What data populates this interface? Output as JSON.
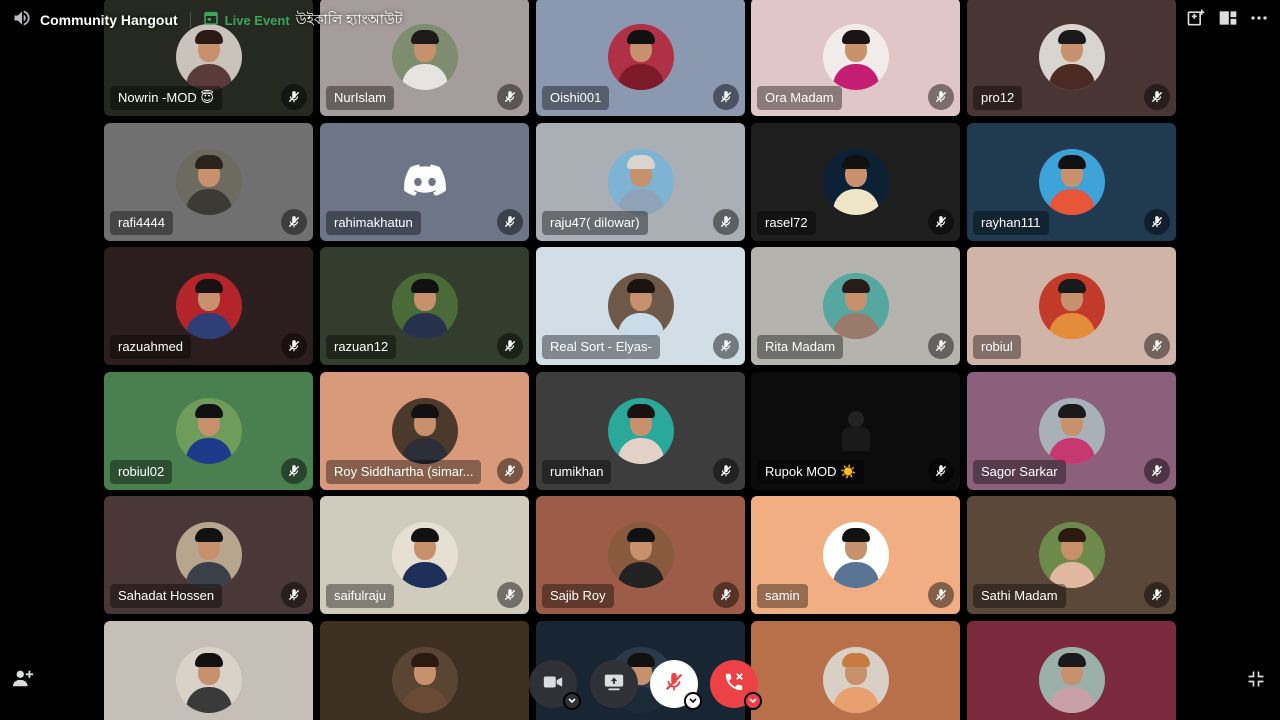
{
  "header": {
    "channel_name": "Community Hangout",
    "event_label": "Live Event",
    "event_name": "উইকালি হ্যাংআউট"
  },
  "participants": [
    {
      "name": "Nowrin -MOD 😇",
      "bg": "#25291f",
      "avatar": "#c9c3bb",
      "hair": "#2a1a14",
      "shirt": "#5b3a3a"
    },
    {
      "name": "NurIslam",
      "bg": "#a59d9c",
      "avatar": "#7e8c6f",
      "hair": "#1d1a18",
      "shirt": "#e6e4e0"
    },
    {
      "name": "Oishi001",
      "bg": "#8a98b0",
      "avatar": "#b03046",
      "hair": "#111",
      "shirt": "#7c1a2a"
    },
    {
      "name": "Ora Madam",
      "bg": "#e0c6c8",
      "avatar": "#f1ecea",
      "hair": "#1c1414",
      "shirt": "#c41e72"
    },
    {
      "name": "pro12",
      "bg": "#4a3535",
      "avatar": "#d8d4cf",
      "hair": "#1a1a1a",
      "shirt": "#4a2a22"
    },
    {
      "name": "rafi4444",
      "bg": "#707070",
      "avatar": "#6d6a60",
      "hair": "#2a241c",
      "shirt": "#3c3a34"
    },
    {
      "name": "rahimakhatun",
      "bg": "#6e7588",
      "avatar": "",
      "hair": "",
      "shirt": "",
      "discord": true
    },
    {
      "name": "raju47( dilowar)",
      "bg": "#a9afb5",
      "avatar": "#7eb3d4",
      "hair": "#d9d4cf",
      "shirt": "#8fa3b8"
    },
    {
      "name": "rasel72",
      "bg": "#1e1e1e",
      "avatar": "#0c2036",
      "hair": "#111",
      "shirt": "#efe6c8"
    },
    {
      "name": "rayhan111",
      "bg": "#203a50",
      "avatar": "#3da3d8",
      "hair": "#111",
      "shirt": "#e8563a"
    },
    {
      "name": "razuahmed",
      "bg": "#2c1e1e",
      "avatar": "#b3252a",
      "hair": "#1a1212",
      "shirt": "#2e3f78"
    },
    {
      "name": "razuan12",
      "bg": "#333d2d",
      "avatar": "#4a6a38",
      "hair": "#111",
      "shirt": "#25314d"
    },
    {
      "name": "Real Sort - Elyas-",
      "bg": "#d2dee6",
      "avatar": "#6e5848",
      "hair": "#1a1410",
      "shirt": "#c9dde8"
    },
    {
      "name": "Rita Madam",
      "bg": "#b4b3ae",
      "avatar": "#55a7a0",
      "hair": "#2a1c18",
      "shirt": "#9a7a6a"
    },
    {
      "name": "robiul",
      "bg": "#d1b4a8",
      "avatar": "#c23a2a",
      "hair": "#1a1a1a",
      "shirt": "#e58c3a"
    },
    {
      "name": "robiul02",
      "bg": "#4a7f4f",
      "avatar": "#6e9c5a",
      "hair": "#111",
      "shirt": "#1d3a8a"
    },
    {
      "name": "Roy Siddhartha (simar...",
      "bg": "#d99a7c",
      "avatar": "#4b3a2c",
      "hair": "#111",
      "shirt": "#2c2f38"
    },
    {
      "name": "rumikhan",
      "bg": "#3d3d3d",
      "avatar": "#2aa89a",
      "hair": "#1a1212",
      "shirt": "#e4d2c8"
    },
    {
      "name": "Rupok MOD ☀️",
      "bg": "#0c0c0c",
      "avatar": "",
      "hair": "",
      "shirt": "",
      "plain": true
    },
    {
      "name": "Sagor Sarkar",
      "bg": "#8c5f7c",
      "avatar": "#a8b0b8",
      "hair": "#1a1a1a",
      "shirt": "#c83870"
    },
    {
      "name": "Sahadat Hossen",
      "bg": "#4a3838",
      "avatar": "#b7a58e",
      "hair": "#111",
      "shirt": "#3b3f48"
    },
    {
      "name": "saifulraju",
      "bg": "#cfcbbd",
      "avatar": "#e6e0d2",
      "hair": "#111",
      "shirt": "#1e2f5a"
    },
    {
      "name": "Sajib Roy",
      "bg": "#9c5c48",
      "avatar": "#8a5a3e",
      "hair": "#111",
      "shirt": "#222"
    },
    {
      "name": "samin",
      "bg": "#f1ae82",
      "avatar": "#ffffff",
      "hair": "#111",
      "shirt": "#5a7494"
    },
    {
      "name": "Sathi Madam",
      "bg": "#5c4838",
      "avatar": "#6e8a4a",
      "hair": "#2a1a10",
      "shirt": "#e0b8a0"
    },
    {
      "name": "",
      "bg": "#c6bfb8",
      "avatar": "#d8d2c8",
      "hair": "#111",
      "shirt": "#3a3a3a"
    },
    {
      "name": "",
      "bg": "#3e3020",
      "avatar": "#5a4434",
      "hair": "#2a1a10",
      "shirt": "#6a4a34"
    },
    {
      "name": "",
      "bg": "#182634",
      "avatar": "#2a3a48",
      "hair": "#111",
      "shirt": "#1c2a38"
    },
    {
      "name": "",
      "bg": "#b8704a",
      "avatar": "#d8d0c4",
      "hair": "#c87a40",
      "shirt": "#e8a070"
    },
    {
      "name": "",
      "bg": "#7a2a3c",
      "avatar": "#9ab0a8",
      "hair": "#1a1a1a",
      "shirt": "#c8a0a8"
    }
  ],
  "controls": {
    "camera": "camera-off",
    "screen_share": "screen-share",
    "mic": "mic-muted",
    "disconnect": "disconnect"
  }
}
